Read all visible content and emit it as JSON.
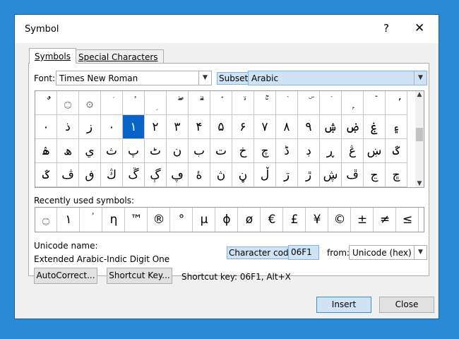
{
  "window": {
    "title": "Symbol",
    "help": "?",
    "close": "✕"
  },
  "tabs": [
    {
      "label": "Symbols"
    },
    {
      "label": "Special Characters"
    }
  ],
  "font": {
    "label": "Font:",
    "value": "Times New Roman"
  },
  "subset": {
    "label": "Subset:",
    "value": "Arabic"
  },
  "grid": {
    "rows": [
      [
        "ٌ",
        "۝",
        "۞",
        "ؘ",
        "ؙ",
        "ؚ",
        "ۖ",
        "ۗ",
        "ۘ",
        "ۙ",
        "ۚ",
        "ۛ",
        "ۜ",
        "ۛ",
        "ۭ",
        "ۡ",
        "ۢ"
      ],
      [
        "٠",
        "ذ",
        "ز",
        "٠",
        "١",
        "٢",
        "٣",
        "۴",
        "۵",
        "۶",
        "۷",
        "۸",
        "۹",
        "ۺ",
        "ۻ",
        "ۼ",
        "۽"
      ],
      [
        "ۿ",
        "ھ",
        "ي",
        "ث",
        "پ",
        "ٹ",
        "ن",
        "ب",
        "ت",
        "خ",
        "چ",
        "ڈ",
        "ڊ",
        "ڕ",
        "ڠ",
        "ښ",
        "ػ"
      ],
      [
        "ػ",
        "ڤ",
        "ڧ",
        "ڭ",
        "ڱ",
        "ڳ",
        "ڥ",
        "ۀ",
        "ڽ",
        "ڼ",
        "ڵ",
        "ڗ",
        "ڙ",
        "ڜ",
        "ڦ",
        "ڃ",
        "ڇ"
      ]
    ],
    "selected": "١"
  },
  "recent": {
    "label": "Recently used symbols:",
    "symbols": [
      "۝",
      "١",
      "ؙ",
      "η",
      "™",
      "®",
      "°",
      "µ",
      "ɸ",
      "ø",
      "€",
      "£",
      "¥",
      "©",
      "±",
      "≠",
      "≤"
    ]
  },
  "unicode": {
    "name_label": "Unicode name:",
    "name_value": "Extended Arabic-Indic Digit One"
  },
  "charcode": {
    "label": "Character code:",
    "value": "06F1",
    "from_label": "from:",
    "from_value": "Unicode (hex)"
  },
  "buttons": {
    "autocorrect": "AutoCorrect...",
    "shortcut_key": "Shortcut Key...",
    "insert": "Insert",
    "close": "Close"
  },
  "shortcut_text": "Shortcut key: 06F1, Alt+X"
}
